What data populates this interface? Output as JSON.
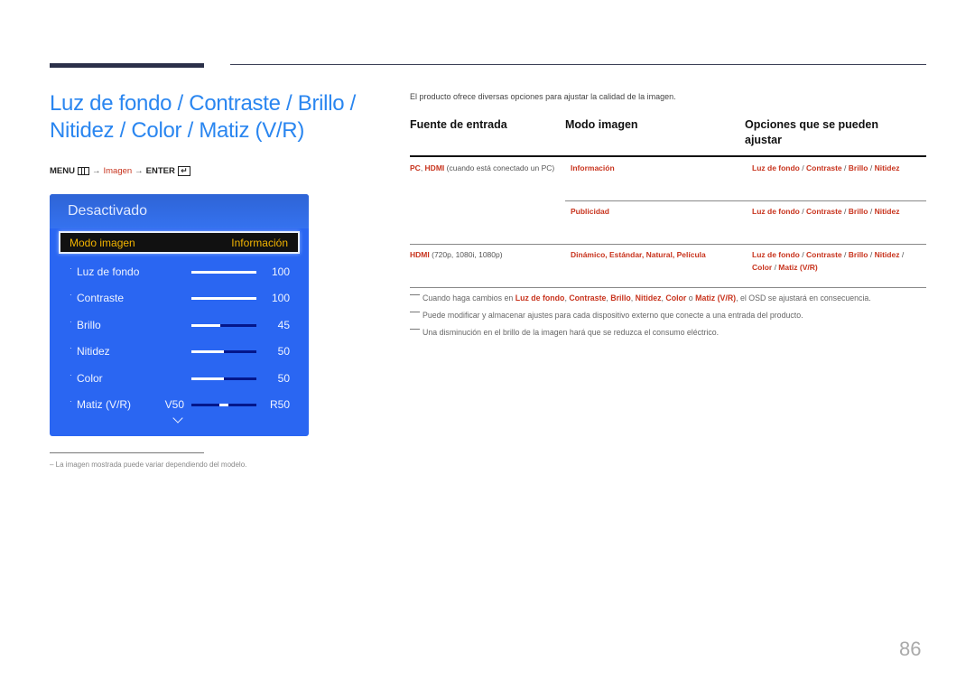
{
  "title": "Luz de fondo / Contraste / Brillo / Nitidez / Color / Matiz (V/R)",
  "breadcrumb": {
    "menu": "MENU",
    "arrow": "→",
    "imagen": "Imagen",
    "enter": "ENTER",
    "enter_glyph": "↵"
  },
  "osd": {
    "header": "Desactivado",
    "selected": {
      "label": "Modo imagen",
      "value": "Información"
    },
    "dot": "·",
    "rows": [
      {
        "label": "Luz de fondo",
        "prefix": "",
        "value": "100",
        "level": 100
      },
      {
        "label": "Contraste",
        "prefix": "",
        "value": "100",
        "level": 100
      },
      {
        "label": "Brillo",
        "prefix": "",
        "value": "45",
        "level": 45
      },
      {
        "label": "Nitidez",
        "prefix": "",
        "value": "50",
        "level": 50
      },
      {
        "label": "Color",
        "prefix": "",
        "value": "50",
        "level": 50
      },
      {
        "label": "Matiz (V/R)",
        "prefix": "V50",
        "value": "R50",
        "level": 50,
        "balance": true
      }
    ]
  },
  "footnote": "–  La imagen mostrada puede variar dependiendo del modelo.",
  "intro": "El producto ofrece diversas opciones para ajustar la calidad de la imagen.",
  "table": {
    "headers": [
      "Fuente de entrada",
      "Modo imagen",
      "Opciones que se pueden ajustar"
    ],
    "rows": [
      {
        "source_bold": [
          "PC",
          "HDMI"
        ],
        "source_rest": "(cuando está conectado un PC)",
        "mode": "Información",
        "options": [
          "Luz de fondo",
          "Contraste",
          "Brillo",
          "Nitidez"
        ]
      },
      {
        "source_bold": [],
        "source_rest": "",
        "mode": "Publicidad",
        "options": [
          "Luz de fondo",
          "Contraste",
          "Brillo",
          "Nitidez"
        ]
      },
      {
        "source_bold": [
          "HDMI"
        ],
        "source_rest": "(720p, 1080i, 1080p)",
        "mode": "Dinámico, Estándar, Natural, Película",
        "options": [
          "Luz de fondo",
          "Contraste",
          "Brillo",
          "Nitidez",
          "Color",
          "Matiz (V/R)"
        ]
      }
    ]
  },
  "notes": {
    "n1_pre": "Cuando haga cambios en ",
    "n1_items": [
      "Luz de fondo",
      "Contraste",
      "Brillo",
      "Nitidez",
      "Color"
    ],
    "n1_or": " o ",
    "n1_last": "Matiz (V/R)",
    "n1_post": ", el OSD se ajustará en consecuencia.",
    "n2": "Puede modificar y almacenar ajustes para cada dispositivo externo que conecte a una entrada del producto.",
    "n3": "Una disminución en el brillo de la imagen hará que se reduzca el consumo eléctrico."
  },
  "page_number": "86"
}
